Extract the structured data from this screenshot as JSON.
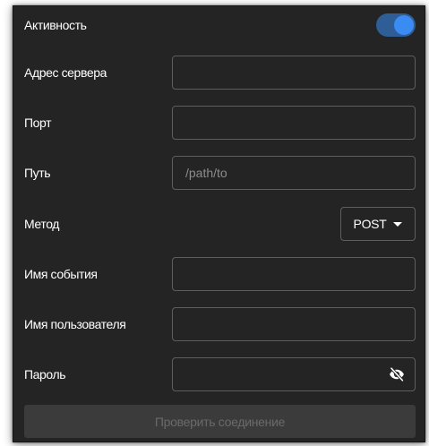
{
  "active": {
    "label": "Активность",
    "enabled": true,
    "accent_color": "#3b8cf2"
  },
  "server_address": {
    "label": "Адрес сервера",
    "value": "",
    "placeholder": ""
  },
  "port": {
    "label": "Порт",
    "value": "",
    "placeholder": ""
  },
  "path": {
    "label": "Путь",
    "value": "",
    "placeholder": "/path/to"
  },
  "method": {
    "label": "Метод",
    "selected": "POST"
  },
  "event_name": {
    "label": "Имя события",
    "value": "",
    "placeholder": ""
  },
  "username": {
    "label": "Имя пользователя",
    "value": "",
    "placeholder": ""
  },
  "password": {
    "label": "Пароль",
    "value": "",
    "placeholder": "",
    "visibility_icon": "eye-off-icon"
  },
  "check_button": {
    "label": "Проверить соединение",
    "enabled": false
  }
}
